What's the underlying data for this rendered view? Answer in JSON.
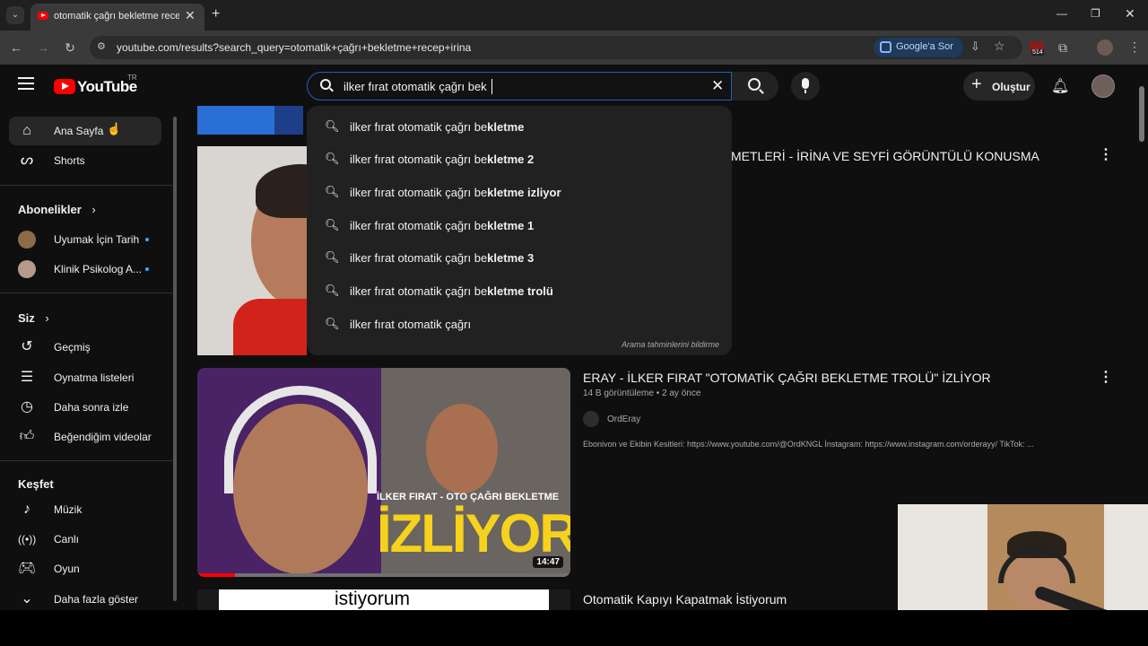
{
  "browser": {
    "tab_title": "otomatik çağrı bekletme recep",
    "url": "youtube.com/results?search_query=otomatik+çağrı+bekletme+recep+irina",
    "google_sor_label": "Google'a Sor",
    "extension_badge": "514"
  },
  "youtube": {
    "logo_text": "YouTube",
    "region": "TR",
    "search_value": "ilker fırat otomatik çağrı bek",
    "create_label": "Oluştur"
  },
  "sidebar": {
    "home": "Ana Sayfa",
    "shorts": "Shorts",
    "subscriptions_header": "Abonelikler",
    "subscriptions": [
      {
        "name": "Uyumak İçin Tarih"
      },
      {
        "name": "Klinik Psikolog A..."
      }
    ],
    "you_header": "Siz",
    "you_items": [
      {
        "label": "Geçmiş"
      },
      {
        "label": "Oynatma listeleri"
      },
      {
        "label": "Daha sonra izle"
      },
      {
        "label": "Beğendiğim videolar"
      }
    ],
    "explore_header": "Keşfet",
    "explore_items": [
      {
        "label": "Müzik"
      },
      {
        "label": "Canlı"
      },
      {
        "label": "Oyun"
      },
      {
        "label": "Daha fazla göster"
      }
    ]
  },
  "suggestions": [
    {
      "prefix": "ilker fırat otomatik çağrı be",
      "bold": "kletme"
    },
    {
      "prefix": "ilker fırat otomatik çağrı be",
      "bold": "kletme 2"
    },
    {
      "prefix": "ilker fırat otomatik çağrı be",
      "bold": "kletme izliyor"
    },
    {
      "prefix": "ilker fırat otomatik çağrı be",
      "bold": "kletme 1"
    },
    {
      "prefix": "ilker fırat otomatik çağrı be",
      "bold": "kletme 3"
    },
    {
      "prefix": "ilker fırat otomatik çağrı be",
      "bold": "kletme trolü"
    },
    {
      "prefix": "ilker fırat otomatik çağrı",
      "bold": ""
    }
  ],
  "suggest_footer": "Arama tahminlerini bildirme",
  "results": [
    {
      "title": "METLERİ - İRİNA VE SEYFİ GÖRÜNTÜLÜ KONUSMA"
    },
    {
      "title": "ERAY - İLKER FIRAT \"OTOMATİK ÇAĞRI BEKLETME TROLÜ\" İZLİYOR",
      "views": "14 B görüntüleme",
      "age": "2 ay önce",
      "channel": "OrdEray",
      "description": "Ebonivon ve Ekibin Kesitleri: https://www.youtube.com/@OrdKNGL İnstagram: https://www.instagram.com/orderayy/ TikTok: ...",
      "duration": "14:47",
      "thumb_overlay_top": "İLKER FIRAT - OTO ÇAĞRI BEKLETME",
      "thumb_overlay_big": "İZLİYOR"
    },
    {
      "title": "Otomatik Kapıyı Kapatmak İstiyorum",
      "thumb_text": "istiyorum"
    }
  ],
  "colors": {
    "accent_red": "#ff0000",
    "search_border": "#1c62b9",
    "subscription_dot": "#3ea6ff"
  }
}
